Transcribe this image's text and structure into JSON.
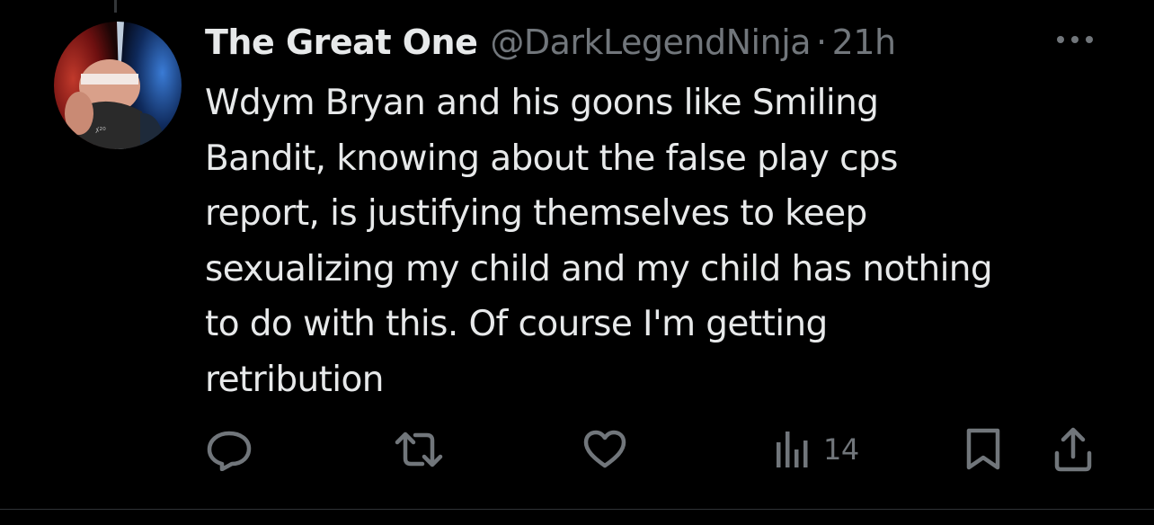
{
  "tweet": {
    "author": {
      "display_name": "The Great One",
      "handle": "@DarkLegendNinja",
      "separator": "·",
      "timestamp": "21h"
    },
    "text_lines": [
      "Wdym Bryan and his goons like Smiling",
      "Bandit, knowing about the false play cps",
      "report, is justifying themselves to keep",
      "sexualizing my child and my child has nothing",
      "to do with this. Of course I'm getting",
      "retribution"
    ],
    "actions": {
      "views_count": "14"
    },
    "icons": {
      "more": "more-horizontal-icon",
      "reply": "reply-icon",
      "repost": "repost-icon",
      "like": "heart-icon",
      "views": "views-bar-chart-icon",
      "bookmark": "bookmark-icon",
      "share": "share-icon"
    },
    "colors": {
      "background": "#000000",
      "primary_text": "#e7e9ea",
      "secondary_text": "#71767b",
      "divider": "#2f3336"
    }
  }
}
